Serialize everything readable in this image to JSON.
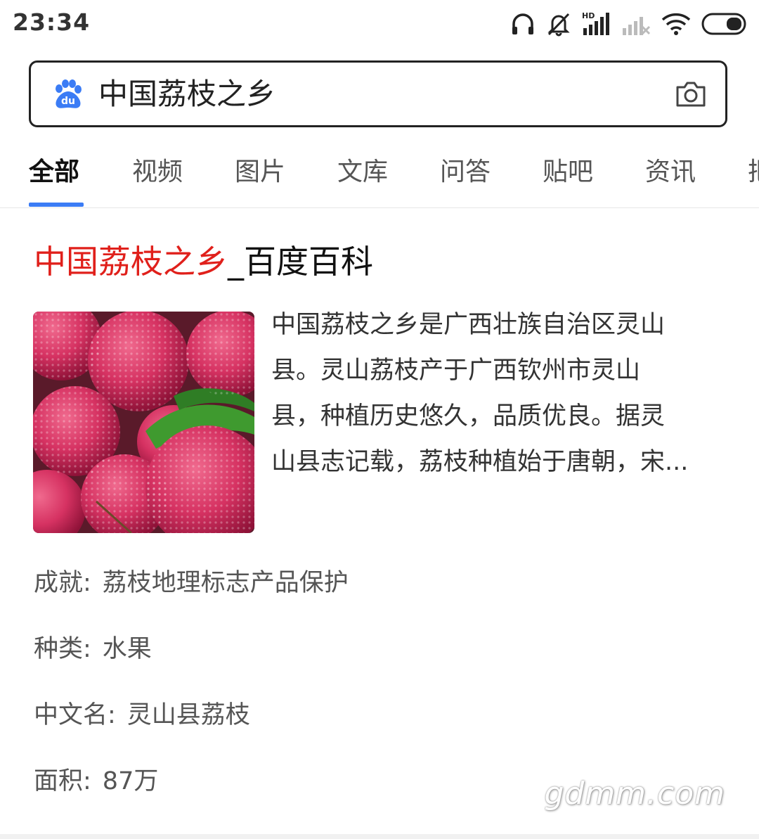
{
  "status_bar": {
    "time": "23:34",
    "icons": [
      "headphones-icon",
      "mute-icon",
      "hd-signal-icon",
      "weak-signal-icon",
      "wifi-icon",
      "battery-icon"
    ],
    "hd_label": "HD"
  },
  "search": {
    "query": "中国荔枝之乡",
    "logo": "baidu-paw-icon",
    "logo_text": "du",
    "camera": "camera-icon",
    "colors": {
      "logo": "#3b7cf5"
    }
  },
  "tabs": [
    {
      "label": "全部",
      "active": true
    },
    {
      "label": "视频"
    },
    {
      "label": "图片"
    },
    {
      "label": "文库"
    },
    {
      "label": "问答"
    },
    {
      "label": "贴吧"
    },
    {
      "label": "资讯"
    },
    {
      "label": "把"
    }
  ],
  "result": {
    "title_highlight": "中国荔枝之乡",
    "title_rest": "_百度百科",
    "summary_lines": [
      "中国荔枝之乡是广西壮族自治区灵山",
      "县。灵山荔枝产于广西钦州市灵山",
      "县，种植历史悠久，品质优良。据灵",
      "山县志记载，荔枝种植始于唐朝，宋..."
    ],
    "info": [
      {
        "label": "成就:",
        "value": "荔枝地理标志产品保护"
      },
      {
        "label": "种类:",
        "value": "水果"
      },
      {
        "label": "中文名:",
        "value": "灵山县荔枝"
      },
      {
        "label": "面积:",
        "value": "87万"
      }
    ],
    "colors": {
      "highlight": "#e0201b"
    }
  },
  "watermark": "gdmm.com"
}
